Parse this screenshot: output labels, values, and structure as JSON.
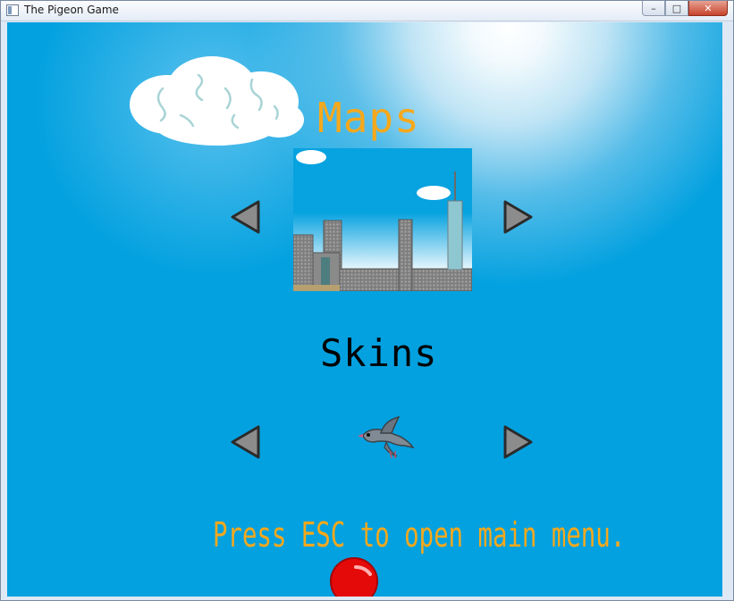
{
  "window": {
    "title": "The Pigeon Game",
    "close_label": "✕",
    "min_label": "–",
    "max_label": "□"
  },
  "maps": {
    "heading": "Maps",
    "selected_map": "city-skyline"
  },
  "skins": {
    "heading": "Skins",
    "selected_skin": "gray-pigeon"
  },
  "hint": "Press ESC to open main menu.",
  "colors": {
    "sky": "#03a1e0",
    "heading_orange": "#f6a81c",
    "arrow_fill": "#8c8c8c"
  },
  "icons": {
    "prev_arrow": "triangle-left-icon",
    "next_arrow": "triangle-right-icon"
  }
}
